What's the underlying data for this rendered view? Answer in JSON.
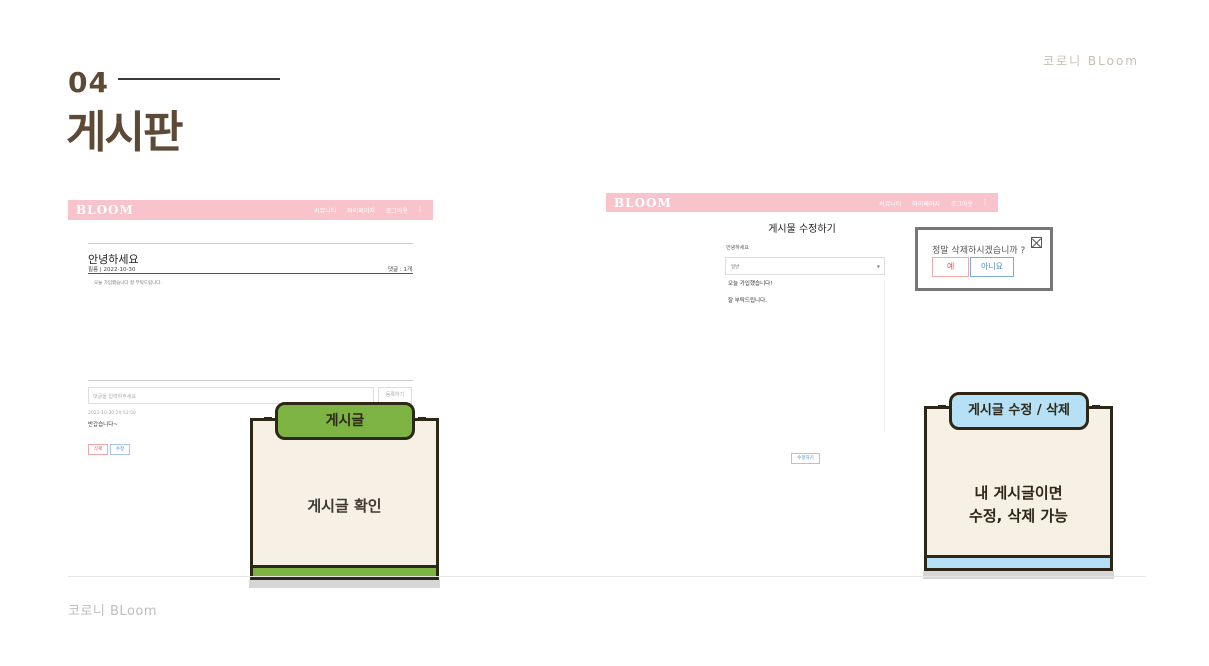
{
  "section": {
    "number": "04",
    "title": "게시판"
  },
  "brand": {
    "top": "코로니 BLoom",
    "bottom": "코로니 BLoom"
  },
  "screen_post": {
    "nav": {
      "logo": "BLOOM",
      "links": [
        "커뮤니티",
        "마이페이지",
        "로그아웃",
        "|"
      ]
    },
    "title": "안녕하세요",
    "meta": "필름 | 2022-10-30",
    "comment_count": "댓글 : 1개",
    "body": "오늘 가입했습니다 잘 부탁드립니다.",
    "comment_placeholder": "댓글을 입력하주세요",
    "comment_button": "등록하기",
    "comment_date": "2022-10-30 20:53:50",
    "comment_text": "반갑습니다~",
    "delete_label": "삭제",
    "edit_label": "수정"
  },
  "screen_edit": {
    "nav": {
      "logo": "BLOOM",
      "links": [
        "커뮤니티",
        "마이페이지",
        "로그아웃",
        "|"
      ]
    },
    "heading": "게시물 수정하기",
    "field_title": "안녕하세요",
    "select_value": "일반",
    "content_line1": "오늘 가입했습니다!",
    "content_line2": "잘 부탁드립니다.",
    "submit_label": "수정하기"
  },
  "modal": {
    "message": "정말 삭제하시겠습니까 ?",
    "yes": "예",
    "no": "아니요"
  },
  "cards": [
    {
      "tab": "게시글",
      "text": "게시글 확인",
      "accent": "#7cb342"
    },
    {
      "tab": "게시글 수정 / 삭제",
      "line1": "내 게시글이면",
      "line2": "수정, 삭제 가능",
      "accent": "#b5e0f5"
    }
  ],
  "colors": {
    "navbar": "#f9c3cc",
    "title": "#5c4a36",
    "card_bg": "#f6f1e4",
    "card_border": "#2e2718"
  }
}
